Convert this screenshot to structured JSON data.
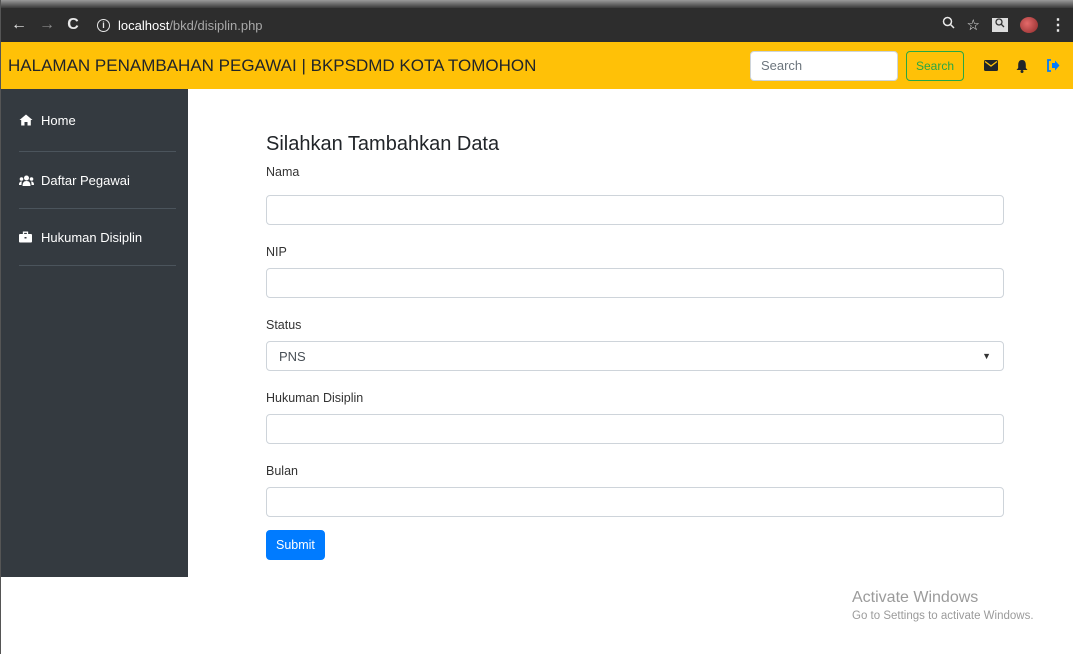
{
  "browser": {
    "url_host": "localhost",
    "url_path": "/bkd/disiplin.php",
    "info_icon_glyph": "i"
  },
  "navbar": {
    "brand": "HALAMAN PENAMBAHAN PEGAWAI | BKPSDMD KOTA TOMOHON",
    "search_placeholder": "Search",
    "search_button": "Search",
    "icons": [
      "envelope-icon",
      "bell-icon",
      "sign-out-icon"
    ],
    "bg_color": "#ffc107"
  },
  "sidebar": {
    "items": [
      {
        "label": "Home",
        "icon": "home-icon"
      },
      {
        "label": "Daftar Pegawai",
        "icon": "users-icon"
      },
      {
        "label": "Hukuman Disiplin",
        "icon": "briefcase-icon"
      }
    ]
  },
  "form": {
    "title": "Silahkan Tambahkan Data",
    "fields": [
      {
        "label": "Nama",
        "value": ""
      },
      {
        "label": "NIP",
        "value": ""
      },
      {
        "label": "Status",
        "value": "PNS"
      },
      {
        "label": "Hukuman Disiplin",
        "value": ""
      },
      {
        "label": "Bulan",
        "value": ""
      }
    ],
    "submit_label": "Submit"
  },
  "watermark": {
    "line1": "Activate Windows",
    "line2": "Go to Settings to activate Windows."
  }
}
